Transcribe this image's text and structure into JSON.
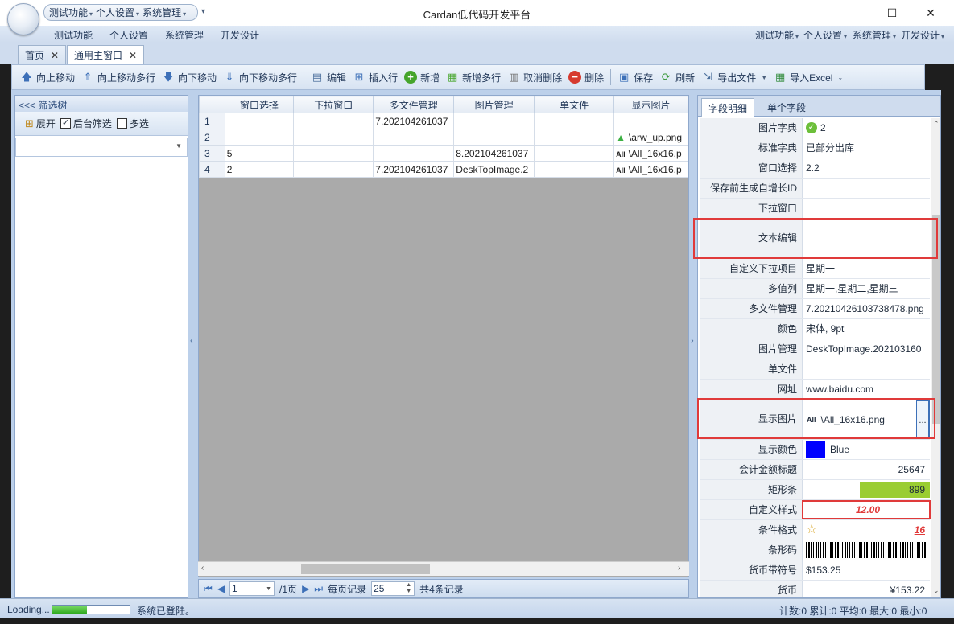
{
  "app": {
    "title": "Cardan低代码开发平台",
    "quick_access": [
      "测试功能",
      "个人设置",
      "系统管理"
    ],
    "quick_more": "▾",
    "window": {
      "minimize": "—",
      "maximize": "☐",
      "close": "✕"
    }
  },
  "menubar": {
    "left": [
      "测试功能",
      "个人设置",
      "系统管理",
      "开发设计"
    ],
    "right": [
      "测试功能",
      "个人设置",
      "系统管理",
      "开发设计"
    ]
  },
  "tabs": [
    {
      "label": "首页",
      "active": false
    },
    {
      "label": "通用主窗口",
      "active": true
    }
  ],
  "toolbar": [
    {
      "label": "向上移动",
      "icon": "arrow-up-icon"
    },
    {
      "label": "向上移动多行",
      "icon": "arrow-up-multi-icon"
    },
    {
      "label": "向下移动",
      "icon": "arrow-down-icon"
    },
    {
      "label": "向下移动多行",
      "icon": "arrow-down-multi-icon"
    },
    {
      "label": "编辑",
      "icon": "edit-icon"
    },
    {
      "label": "插入行",
      "icon": "insert-row-icon"
    },
    {
      "label": "新增",
      "icon": "add-icon"
    },
    {
      "label": "新增多行",
      "icon": "add-multi-icon"
    },
    {
      "label": "取消删除",
      "icon": "undo-delete-icon"
    },
    {
      "label": "删除",
      "icon": "delete-icon"
    },
    {
      "label": "保存",
      "icon": "save-icon"
    },
    {
      "label": "刷新",
      "icon": "refresh-icon"
    },
    {
      "label": "导出文件",
      "icon": "export-icon"
    },
    {
      "label": "导入Excel",
      "icon": "import-excel-icon"
    }
  ],
  "left_panel": {
    "header": "<<< 筛选树",
    "expand": "展开",
    "bg_filter": "后台筛选",
    "bg_filter_checked": true,
    "multi_select": "多选",
    "multi_select_checked": false
  },
  "grid": {
    "columns": [
      "窗口选择",
      "下拉窗口",
      "多文件管理",
      "图片管理",
      "单文件",
      "显示图片"
    ],
    "rows": [
      {
        "n": "1",
        "cells": [
          "",
          "",
          "7.202104261037",
          "",
          "",
          ""
        ]
      },
      {
        "n": "2",
        "cells": [
          "",
          "",
          "",
          "",
          "",
          "\\arw_up.png"
        ]
      },
      {
        "n": "3",
        "cells": [
          "5",
          "",
          "",
          "8.202104261037",
          "",
          "\\All_16x16.p"
        ]
      },
      {
        "n": "4",
        "cells": [
          "2",
          "",
          "7.202104261037",
          "DeskTopImage.2",
          "",
          "\\All_16x16.p"
        ]
      }
    ],
    "all_badge": "All"
  },
  "pager": {
    "page": "1",
    "total_pages": "/1页",
    "per_page_label": "每页记录",
    "per_page": "25",
    "total": "共4条记录"
  },
  "props": {
    "tabs": [
      "字段明细",
      "单个字段"
    ],
    "rows": [
      {
        "label": "图片字典",
        "value": "2"
      },
      {
        "label": "标准字典",
        "value": "已部分出库"
      },
      {
        "label": "窗口选择",
        "value": "2.2"
      },
      {
        "label": "保存前生成自增长ID",
        "value": ""
      },
      {
        "label": "下拉窗口",
        "value": ""
      },
      {
        "label": "文本编辑",
        "value": ""
      },
      {
        "label": "自定义下拉项目",
        "value": "星期一"
      },
      {
        "label": "多值列",
        "value": "星期一,星期二,星期三"
      },
      {
        "label": "多文件管理",
        "value": "7.20210426103738478.png"
      },
      {
        "label": "颜色",
        "value": "宋体, 9pt"
      },
      {
        "label": "图片管理",
        "value": "DeskTopImage.202103160"
      },
      {
        "label": "单文件",
        "value": ""
      },
      {
        "label": "网址",
        "value": "www.baidu.com"
      },
      {
        "label": "显示图片",
        "value": "\\All_16x16.png"
      },
      {
        "label": "显示颜色",
        "value": "Blue"
      },
      {
        "label": "会计金额标题",
        "value": "25647"
      },
      {
        "label": "矩形条",
        "value": "899"
      },
      {
        "label": "自定义样式",
        "value": "12.00"
      },
      {
        "label": "条件格式",
        "value": "16"
      },
      {
        "label": "条形码",
        "value": ""
      },
      {
        "label": "货币带符号",
        "value": "$153.25"
      },
      {
        "label": "货币",
        "value": "¥153.22"
      }
    ],
    "ellipsis": "...",
    "bar_fraction": 0.55
  },
  "status": {
    "loading": "Loading...",
    "message": "系统已登陆。",
    "summary": "计数:0 累计:0 平均:0 最大:0 最小:0",
    "progress": 0.45
  },
  "colors": {
    "accent": "#3d70b8",
    "display_color": "#0000ff",
    "red_highlight": "#e03a3a",
    "bar": "#9acd32"
  }
}
